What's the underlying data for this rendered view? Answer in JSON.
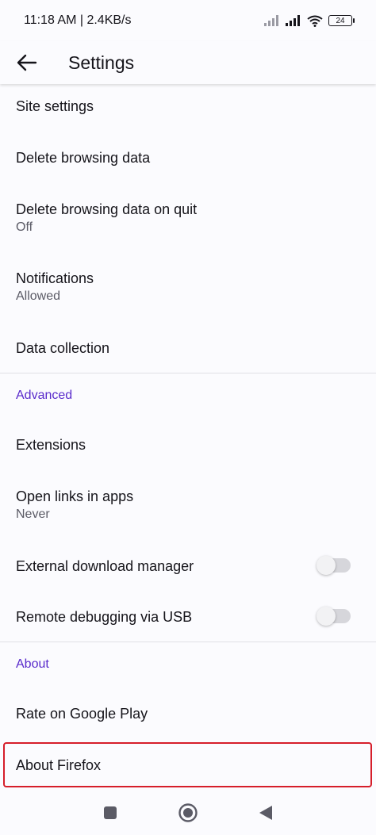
{
  "status_bar": {
    "time": "11:18 AM | 2.4KB/s",
    "battery": "24"
  },
  "app_bar": {
    "title": "Settings"
  },
  "items": {
    "site_settings": {
      "title": "Site settings"
    },
    "delete_browsing_data": {
      "title": "Delete browsing data"
    },
    "delete_on_quit": {
      "title": "Delete browsing data on quit",
      "subtitle": "Off"
    },
    "notifications": {
      "title": "Notifications",
      "subtitle": "Allowed"
    },
    "data_collection": {
      "title": "Data collection"
    },
    "extensions": {
      "title": "Extensions"
    },
    "open_links_in_apps": {
      "title": "Open links in apps",
      "subtitle": "Never"
    },
    "external_download_manager": {
      "title": "External download manager",
      "enabled": false
    },
    "remote_debugging": {
      "title": "Remote debugging via USB",
      "enabled": false
    },
    "rate_on_google_play": {
      "title": "Rate on Google Play"
    },
    "about_firefox": {
      "title": "About Firefox"
    }
  },
  "sections": {
    "advanced": "Advanced",
    "about": "About"
  },
  "colors": {
    "accent": "#592acb",
    "highlight": "#d61e2a",
    "text": "#15141a",
    "secondary_text": "#5b5b66"
  }
}
